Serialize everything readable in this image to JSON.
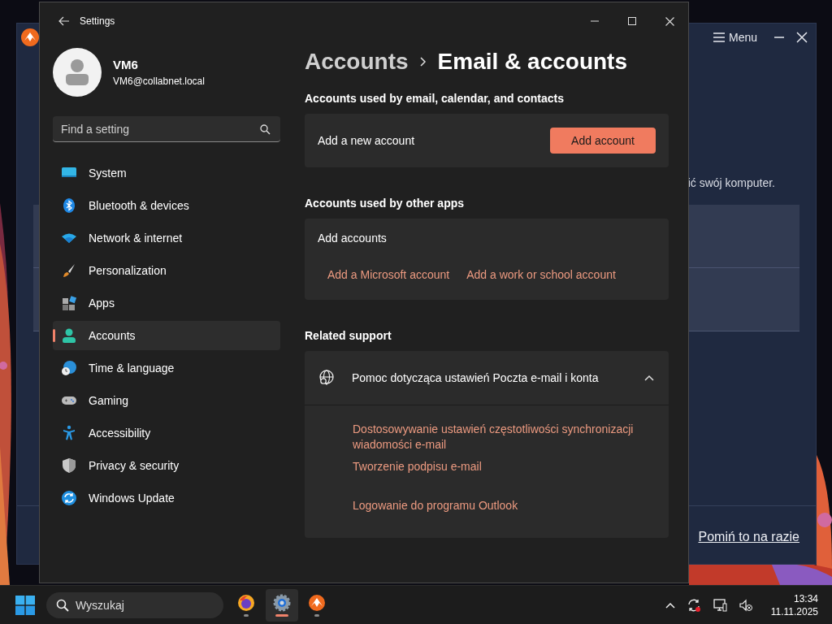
{
  "background_app": {
    "menu_label": "Menu",
    "partial_text": "ić swój komputer.",
    "skip_link": "Pomiń to na razie"
  },
  "window": {
    "title": "Settings"
  },
  "user": {
    "name": "VM6",
    "email": "VM6@collabnet.local"
  },
  "search": {
    "placeholder": "Find a setting"
  },
  "sidebar": {
    "items": [
      {
        "label": "System",
        "selected": false
      },
      {
        "label": "Bluetooth & devices",
        "selected": false
      },
      {
        "label": "Network & internet",
        "selected": false
      },
      {
        "label": "Personalization",
        "selected": false
      },
      {
        "label": "Apps",
        "selected": false
      },
      {
        "label": "Accounts",
        "selected": true
      },
      {
        "label": "Time & language",
        "selected": false
      },
      {
        "label": "Gaming",
        "selected": false
      },
      {
        "label": "Accessibility",
        "selected": false
      },
      {
        "label": "Privacy & security",
        "selected": false
      },
      {
        "label": "Windows Update",
        "selected": false
      }
    ]
  },
  "breadcrumb": {
    "parent": "Accounts",
    "current": "Email & accounts"
  },
  "sections": [
    {
      "title": "Accounts used by email, calendar, and contacts",
      "kind": "action",
      "label": "Add a new account",
      "button": "Add account"
    },
    {
      "title": "Accounts used by other apps",
      "kind": "links",
      "label": "Add accounts",
      "links": [
        "Add a Microsoft account",
        "Add a work or school account"
      ]
    },
    {
      "title": "Related support",
      "kind": "expander",
      "header": "Pomoc dotycząca ustawień Poczta e-mail i konta",
      "expanded": true,
      "links": [
        "Dostosowywanie ustawień częstotliwości synchronizacji wiadomości e-mail",
        "Tworzenie podpisu e-mail",
        "Logowanie do programu Outlook"
      ]
    }
  ],
  "taskbar": {
    "search_placeholder": "Wyszukaj",
    "apps": [
      {
        "selected": false
      },
      {
        "selected": true
      },
      {
        "selected": false
      }
    ],
    "time": "13:34",
    "date": "11.11.2025"
  }
}
